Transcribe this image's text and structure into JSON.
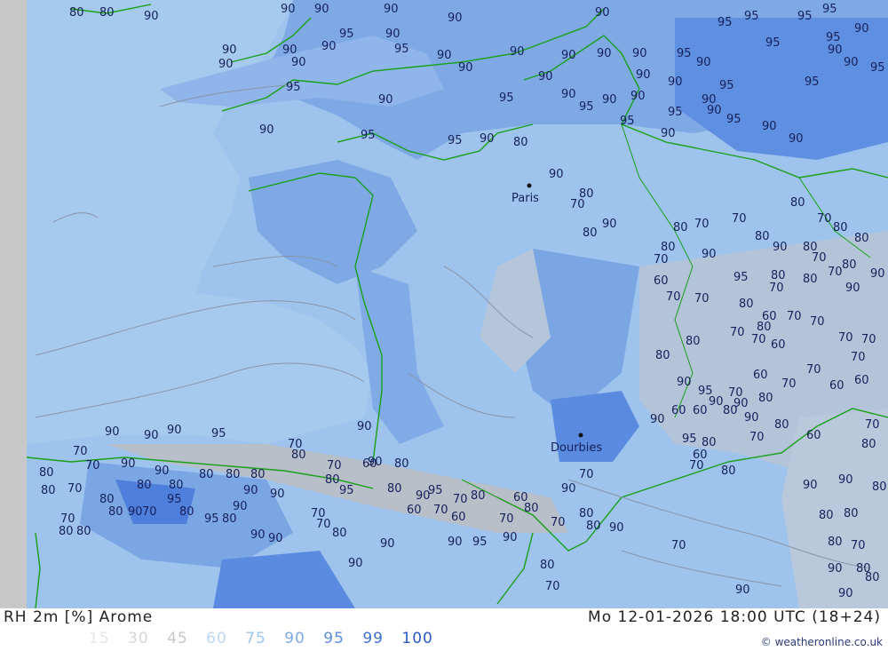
{
  "footer": {
    "title": "RH 2m [%] Arome",
    "datetime": "Mo 12-01-2026 18:00 UTC (18+24)",
    "credit": "© weatheronline.co.uk"
  },
  "legend": [
    {
      "label": "15",
      "color": "#e6e6e6"
    },
    {
      "label": "30",
      "color": "#d6d6d6"
    },
    {
      "label": "45",
      "color": "#c8c8c8"
    },
    {
      "label": "60",
      "color": "#bcd8f2"
    },
    {
      "label": "75",
      "color": "#9ec6ee"
    },
    {
      "label": "90",
      "color": "#7faae6"
    },
    {
      "label": "95",
      "color": "#5c8ce0"
    },
    {
      "label": "99",
      "color": "#3e6fd6"
    },
    {
      "label": "100",
      "color": "#2a58c8"
    }
  ],
  "cities": [
    "Paris",
    "Dourbies"
  ],
  "contour_labels": [
    "80",
    "80",
    "90",
    "90",
    "90",
    "90",
    "90",
    "90",
    "95",
    "95",
    "95",
    "95",
    "95",
    "90",
    "90",
    "90",
    "90",
    "90",
    "90",
    "90",
    "90",
    "90",
    "90",
    "90",
    "90",
    "95",
    "95",
    "90",
    "90",
    "90",
    "95",
    "95",
    "95",
    "90",
    "90",
    "90",
    "90",
    "90",
    "95",
    "95",
    "90",
    "95",
    "95",
    "90",
    "90",
    "95",
    "90",
    "95",
    "95",
    "90",
    "90",
    "90",
    "95",
    "90",
    "90",
    "95",
    "95",
    "90",
    "80",
    "90",
    "80",
    "70",
    "90",
    "80",
    "80",
    "70",
    "70",
    "80",
    "70",
    "80",
    "80",
    "90",
    "80",
    "80",
    "90",
    "80",
    "70",
    "70",
    "80",
    "90",
    "90",
    "95",
    "80",
    "80",
    "70",
    "70",
    "60",
    "70",
    "70",
    "80",
    "60",
    "70",
    "80",
    "70",
    "70",
    "70",
    "70",
    "70",
    "60",
    "60",
    "80",
    "70",
    "60",
    "70",
    "60",
    "70",
    "80",
    "90",
    "95",
    "90",
    "90",
    "80",
    "70",
    "60",
    "60",
    "80",
    "90",
    "80",
    "70",
    "90",
    "95",
    "80",
    "60",
    "70",
    "80",
    "60",
    "70",
    "80",
    "90",
    "90",
    "80",
    "80",
    "80",
    "80",
    "70",
    "90",
    "80",
    "80",
    "90",
    "90",
    "70",
    "90",
    "80",
    "70",
    "90",
    "80",
    "70",
    "80",
    "70",
    "60",
    "70",
    "90",
    "95",
    "80",
    "60",
    "70",
    "80",
    "95",
    "80",
    "60",
    "70",
    "80",
    "60",
    "70",
    "80",
    "90",
    "95",
    "90",
    "90",
    "90",
    "70",
    "70",
    "80",
    "90",
    "90",
    "95",
    "80",
    "90",
    "90",
    "90",
    "95",
    "80",
    "80",
    "80",
    "80",
    "90",
    "70",
    "80",
    "70",
    "80",
    "80",
    "70",
    "90",
    "90",
    "80",
    "80",
    "80",
    "70",
    "90",
    "90",
    "90",
    "95",
    "70",
    "80",
    "90",
    "90",
    "80",
    "80",
    "70"
  ]
}
